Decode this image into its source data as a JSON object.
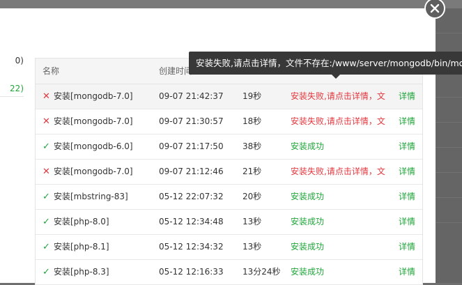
{
  "sidebar": {
    "items": [
      {
        "label": "0)",
        "active": false
      },
      {
        "label": "22)",
        "active": true
      }
    ]
  },
  "table": {
    "headers": {
      "name": "名称",
      "time": "创建时间",
      "duration": "",
      "status": "",
      "action": ""
    },
    "rows": [
      {
        "ok": false,
        "icon": "✕",
        "name": "安装[mongodb-7.0]",
        "time": "09-07 21:42:37",
        "duration": "19秒",
        "status": "安装失败,请点击详情，文",
        "detail": "详情"
      },
      {
        "ok": false,
        "icon": "✕",
        "name": "安装[mongodb-7.0]",
        "time": "09-07 21:30:57",
        "duration": "18秒",
        "status": "安装失败,请点击详情，文",
        "detail": "详情"
      },
      {
        "ok": true,
        "icon": "✓",
        "name": "安装[mongodb-6.0]",
        "time": "09-07 21:17:50",
        "duration": "38秒",
        "status": "安装成功",
        "detail": "详情"
      },
      {
        "ok": false,
        "icon": "✕",
        "name": "安装[mongodb-7.0]",
        "time": "09-07 21:12:46",
        "duration": "21秒",
        "status": "安装失败,请点击详情，文",
        "detail": "详情"
      },
      {
        "ok": true,
        "icon": "✓",
        "name": "安装[mbstring-83]",
        "time": "05-12 22:07:32",
        "duration": "20秒",
        "status": "安装成功",
        "detail": "详情"
      },
      {
        "ok": true,
        "icon": "✓",
        "name": "安装[php-8.0]",
        "time": "05-12 12:34:48",
        "duration": "13秒",
        "status": "安装成功",
        "detail": "详情"
      },
      {
        "ok": true,
        "icon": "✓",
        "name": "安装[php-8.1]",
        "time": "05-12 12:34:32",
        "duration": "13秒",
        "status": "安装成功",
        "detail": "详情"
      },
      {
        "ok": true,
        "icon": "✓",
        "name": "安装[php-8.3]",
        "time": "05-12 12:16:33",
        "duration": "13分24秒",
        "status": "安装成功",
        "detail": "详情"
      }
    ]
  },
  "tooltip": {
    "text": "安装失败,请点击详情，文件不存在:/www/server/mongodb/bin/mong"
  },
  "close": {
    "icon": "close-icon"
  },
  "colors": {
    "success": "#20a53a",
    "error": "#e0383e",
    "tooltip_bg": "#383838"
  }
}
